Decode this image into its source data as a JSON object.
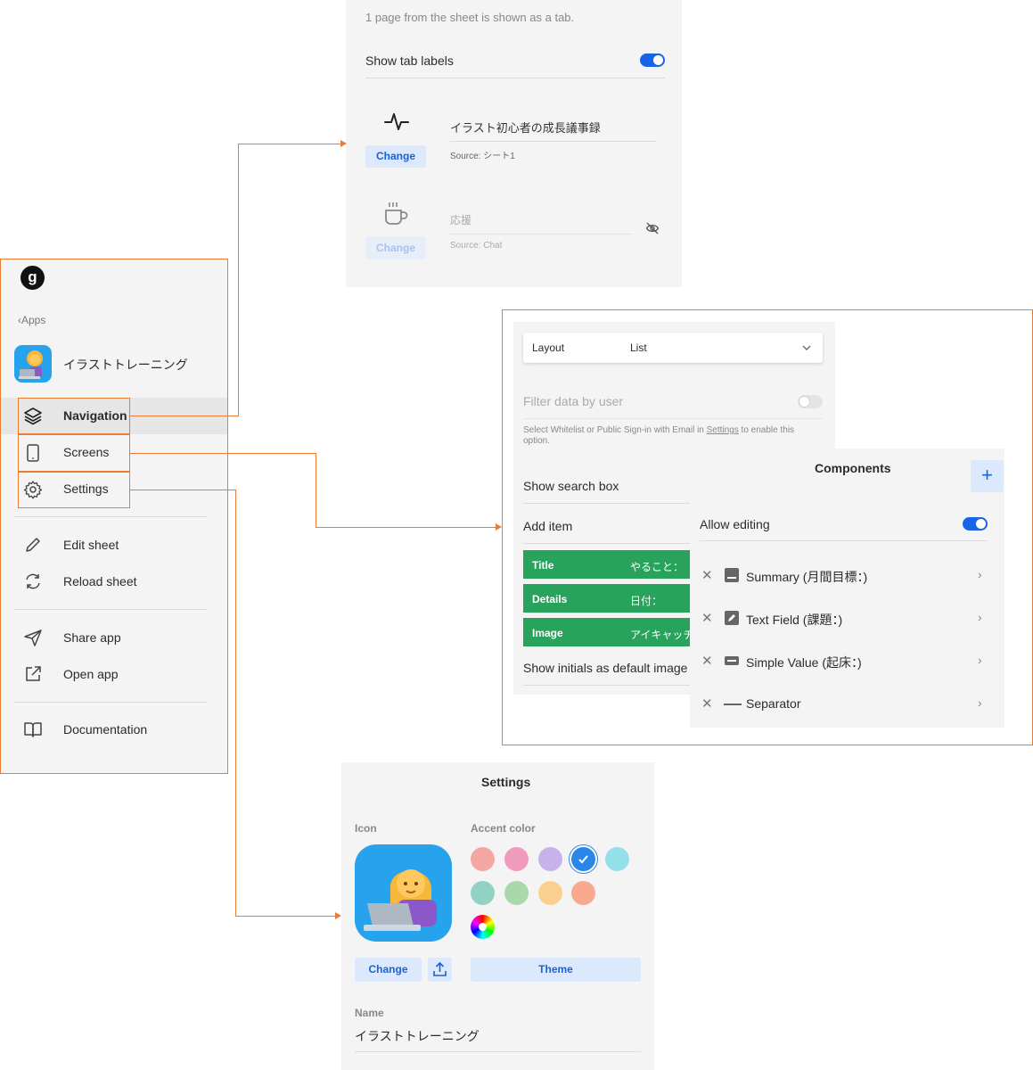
{
  "tabs_panel": {
    "description": "1 page from the sheet is shown as a tab.",
    "show_tab_labels": "Show tab labels",
    "tab1": {
      "name": "イラスト初心者の成長議事録",
      "source": "Source: シート1",
      "change": "Change",
      "icon": "activity-pulse-icon"
    },
    "tab2": {
      "name": "応援",
      "source": "Source: Chat",
      "change": "Change",
      "icon": "coffee-cup-icon",
      "hidden_icon": "eye-off-icon"
    }
  },
  "sidebar": {
    "logo": "g",
    "back": "Apps",
    "app_name": "イラストトレーニング",
    "items": [
      {
        "label": "Navigation",
        "icon": "layers-icon"
      },
      {
        "label": "Screens",
        "icon": "phone-icon"
      },
      {
        "label": "Settings",
        "icon": "gear-icon"
      },
      {
        "label": "Edit sheet",
        "icon": "pencil-icon"
      },
      {
        "label": "Reload sheet",
        "icon": "refresh-icon"
      },
      {
        "label": "Share app",
        "icon": "send-icon"
      },
      {
        "label": "Open app",
        "icon": "external-link-icon"
      },
      {
        "label": "Documentation",
        "icon": "book-icon"
      }
    ]
  },
  "screen_panel": {
    "layout_label": "Layout",
    "layout_value": "List",
    "filter_label": "Filter data by user",
    "filter_note_pre": "Select Whitelist or Public Sign-in with Email in ",
    "filter_note_link": "Settings",
    "filter_note_post": " to enable this option.",
    "show_search": "Show search box",
    "add_item": "Add item",
    "rows": [
      {
        "key": "Title",
        "value": "やること："
      },
      {
        "key": "Details",
        "value": "日付："
      },
      {
        "key": "Image",
        "value": "アイキャッチ"
      }
    ],
    "show_initials": "Show initials as default image"
  },
  "components_panel": {
    "title": "Components",
    "add": "+",
    "allow_editing": "Allow editing",
    "items": [
      {
        "label": "Summary (月間目標：)",
        "icon": "summary-icon"
      },
      {
        "label": "Text Field (課題：)",
        "icon": "text-field-icon"
      },
      {
        "label": "Simple Value (起床：)",
        "icon": "simple-value-icon"
      },
      {
        "label": "Separator",
        "icon": "separator-icon"
      }
    ]
  },
  "settings_panel": {
    "title": "Settings",
    "icon_label": "Icon",
    "accent_label": "Accent color",
    "change": "Change",
    "theme": "Theme",
    "name_label": "Name",
    "name_value": "イラストトレーニング",
    "accent_colors": [
      "#f4a6a3",
      "#f09bbb",
      "#c8b2ea",
      "#2a86e8",
      "#94e0ea",
      "#92d1c4",
      "#a9d8aa",
      "#fbd08e",
      "#f8a98f"
    ],
    "selected_color": "#2a86e8"
  },
  "colors": {
    "annotation": "#ec7b35",
    "accent": "#1764e8",
    "green": "#27a35c"
  }
}
